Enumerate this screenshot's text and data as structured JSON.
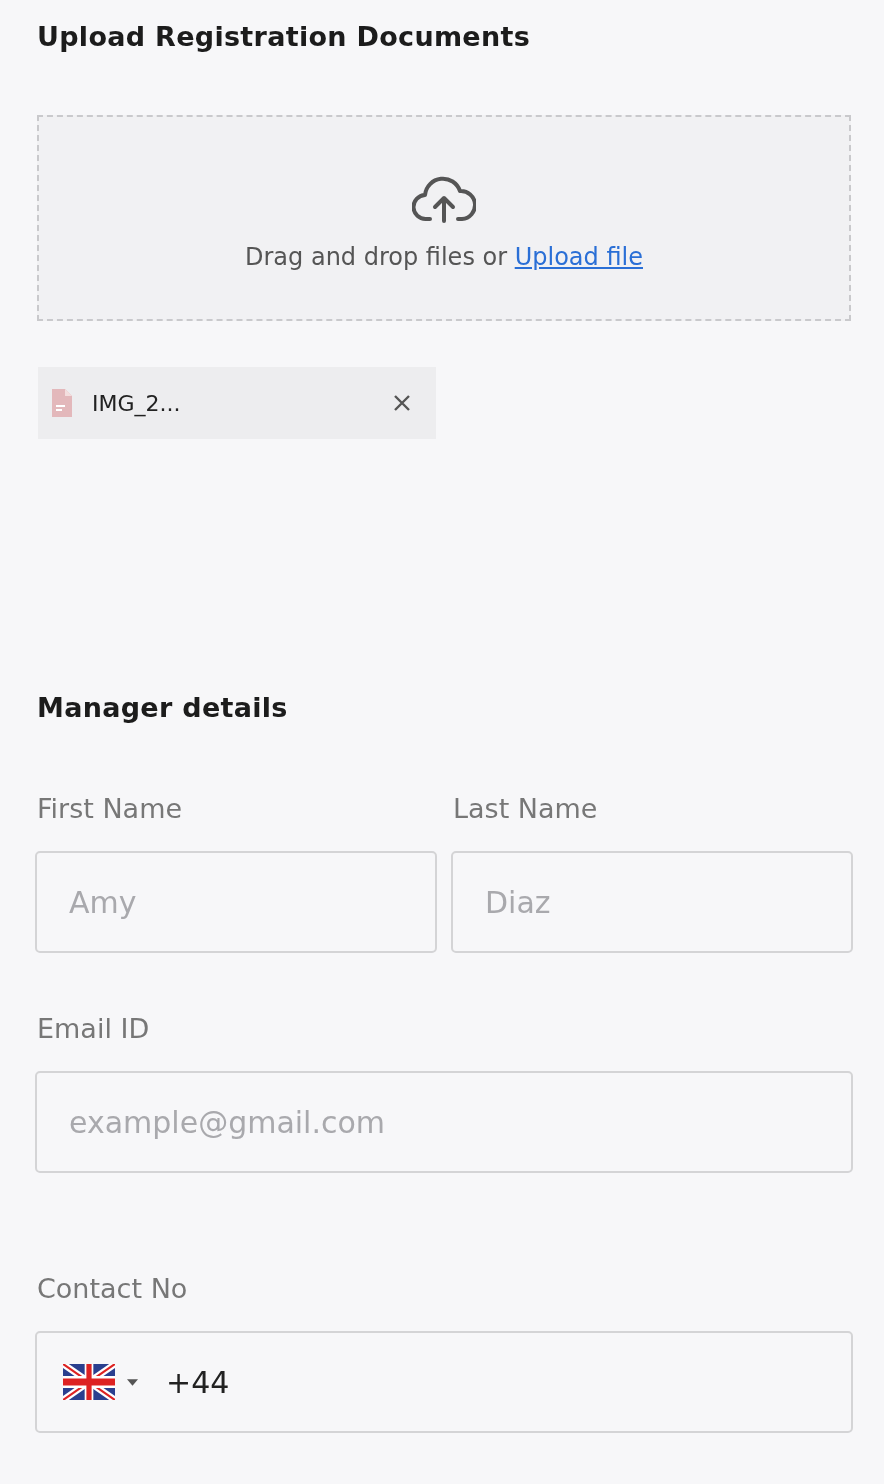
{
  "upload_section": {
    "title": "Upload Registration Documents",
    "dropzone": {
      "text": "Drag and drop files or ",
      "link": "Upload file"
    },
    "files": [
      {
        "name": "IMG_2..."
      }
    ]
  },
  "manager_section": {
    "title": "Manager details",
    "fields": [
      {
        "kind": "half",
        "label": "First Name",
        "placeholder": "Amy"
      },
      {
        "kind": "half",
        "label": "Last Name",
        "placeholder": "Diaz"
      },
      {
        "kind": "full",
        "label": "Email ID",
        "placeholder": "example@gmail.com"
      },
      {
        "kind": "phone",
        "label": "Contact No",
        "value": "+44"
      }
    ]
  }
}
